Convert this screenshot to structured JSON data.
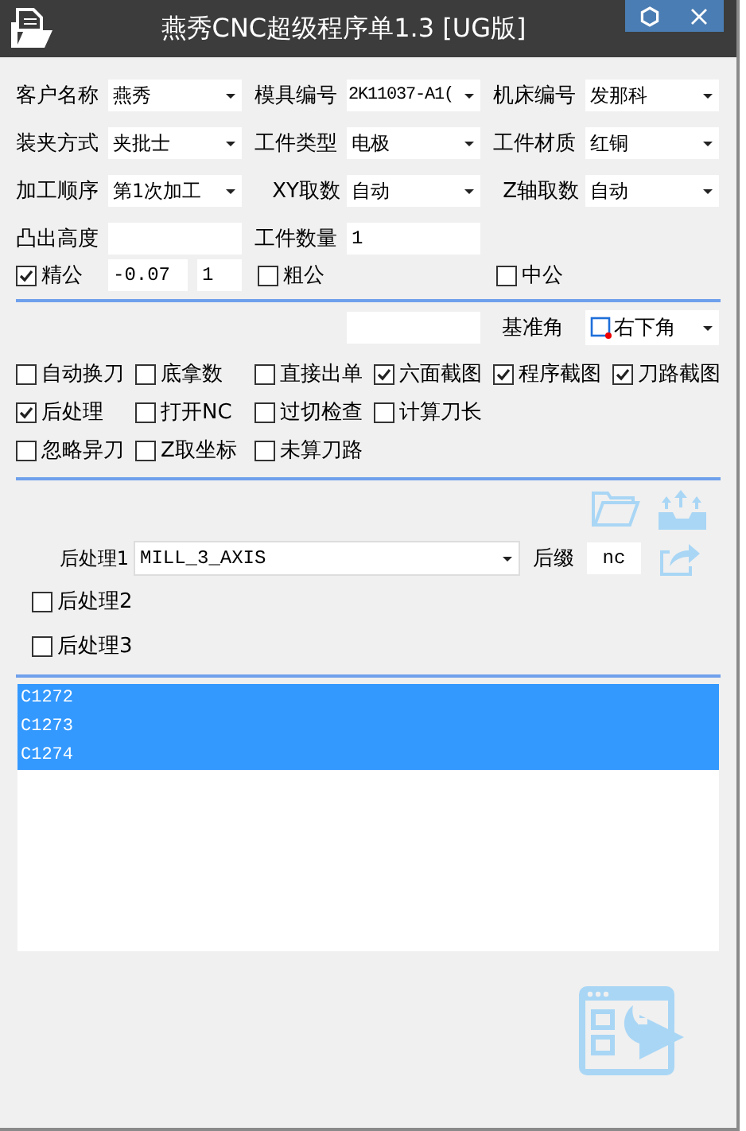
{
  "window": {
    "title": "燕秀CNC超级程序单1.3 [UG版]"
  },
  "combo_rows": [
    [
      {
        "label": "客户名称",
        "value": "燕秀"
      },
      {
        "label": "模具编号",
        "value": "2K11037-A1("
      },
      {
        "label": "机床编号",
        "value": "发那科"
      }
    ],
    [
      {
        "label": "装夹方式",
        "value": "夹批士"
      },
      {
        "label": "工件类型",
        "value": "电极"
      },
      {
        "label": "工件材质",
        "value": "红铜"
      }
    ],
    [
      {
        "label": "加工顺序",
        "value": "第1次加工"
      },
      {
        "label": "XY取数",
        "value": "自动"
      },
      {
        "label": "Z轴取数",
        "value": "自动"
      }
    ]
  ],
  "height_row": {
    "label": "凸出高度",
    "count_label": "工件数量",
    "count_value": "1"
  },
  "tolerance": {
    "fine": {
      "label": "精公",
      "checked": true,
      "value": "-0.07",
      "count": "1"
    },
    "rough": {
      "label": "粗公",
      "checked": false
    },
    "middle": {
      "label": "中公",
      "checked": false
    }
  },
  "reference": {
    "label": "基准角",
    "value": "右下角"
  },
  "options": [
    [
      {
        "label": "自动换刀",
        "checked": false
      },
      {
        "label": "底拿数",
        "checked": false
      },
      {
        "label": "直接出单",
        "checked": false
      },
      {
        "label": "六面截图",
        "checked": true
      },
      {
        "label": "程序截图",
        "checked": true
      },
      {
        "label": "刀路截图",
        "checked": true
      }
    ],
    [
      {
        "label": "后处理",
        "checked": true
      },
      {
        "label": "打开NC",
        "checked": false
      },
      {
        "label": "过切检查",
        "checked": false
      },
      {
        "label": "计算刀长",
        "checked": false
      }
    ],
    [
      {
        "label": "忽略异刀",
        "checked": false
      },
      {
        "label": "Z取坐标",
        "checked": false
      },
      {
        "label": "未算刀路",
        "checked": false
      }
    ]
  ],
  "post": {
    "label": "后处理1",
    "value": "MILL_3_AXIS",
    "suffix_label": "后缀",
    "suffix_value": "nc"
  },
  "extra_posts": [
    {
      "label": "后处理2",
      "checked": false
    },
    {
      "label": "后处理3",
      "checked": false
    }
  ],
  "programs": [
    {
      "name": "C1272",
      "selected": true
    },
    {
      "name": "C1273",
      "selected": true
    },
    {
      "name": "C1274",
      "selected": true
    }
  ]
}
